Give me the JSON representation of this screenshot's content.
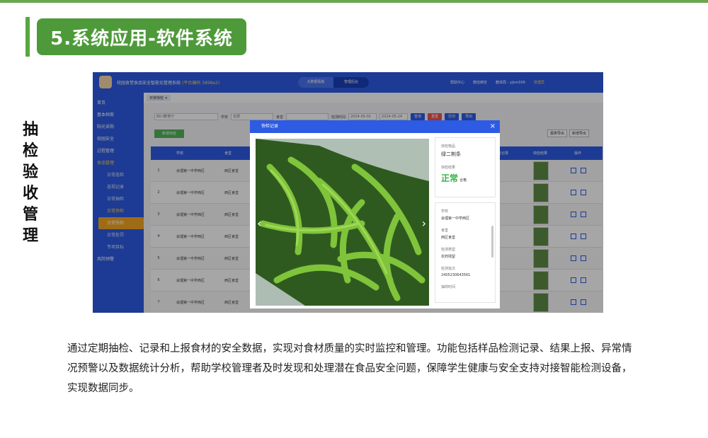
{
  "slide": {
    "title": "5.系统应用-软件系统",
    "side_title": "抽检验收管理",
    "description": "通过定期抽检、记录和上报食材的安全数据，实现对食材质量的实时监控和管理。功能包括样品检测记录、结果上报、异常情况预警以及数据统计分析，帮助学校管理者及时发现和处理潜在食品安全问题，保障学生健康与安全支持对接智能检测设备，实现数据同步。"
  },
  "app": {
    "name": "校园食堂食品安全智能化管理系统",
    "name_accent": "(平台编码 3898e2)",
    "segments": [
      "大数据看板",
      "管理后台"
    ],
    "header_right": [
      "帮助中心",
      "微信绑定",
      "教体局 - yjbm006",
      "管理员"
    ],
    "sidebar": [
      "首页",
      "基本档案",
      "阳光采购",
      "校园安全",
      "过程管理",
      "食品管理",
      "日常巡检",
      "巡视记录",
      "日常抽检",
      "日常快检",
      "日常快检",
      "日常处罚",
      "专项目标",
      "风险预警"
    ],
    "tab": "日常快检 ×",
    "filters": {
      "org": "四川教育厅",
      "school_label": "学校",
      "school": "全部",
      "canteen_label": "食堂",
      "date_label": "检测时间",
      "date_from": "2024-05-01",
      "date_to": "2024-05-24"
    },
    "buttons": {
      "search": "查询",
      "reset": "重置",
      "print": "打印",
      "export": "导出",
      "add": "新增快检",
      "r1": "报表导出",
      "r2": "新增导出"
    },
    "columns": [
      "学校",
      "食堂",
      "快检记录",
      "快检结果",
      "操作"
    ],
    "rows": [
      {
        "idx": "1",
        "school": "会理第一中学西区",
        "canteen": "西区食堂"
      },
      {
        "idx": "2",
        "school": "会理第一中学西区",
        "canteen": "西区食堂"
      },
      {
        "idx": "3",
        "school": "会理第一中学西区",
        "canteen": "西区食堂"
      },
      {
        "idx": "4",
        "school": "会理第一中学西区",
        "canteen": "西区食堂"
      },
      {
        "idx": "5",
        "school": "会理第一中学西区",
        "canteen": "西区食堂"
      },
      {
        "idx": "6",
        "school": "会理第一中学西区",
        "canteen": "西区食堂"
      },
      {
        "idx": "7",
        "school": "会理第一中学西区",
        "canteen": "西区食堂"
      }
    ]
  },
  "modal": {
    "title": "快检记录",
    "item_label": "快检物品",
    "item_value": "绿二荆条",
    "result_label": "快检结果",
    "result_value": "正常",
    "result_unit": "合格",
    "school_label": "学校",
    "school_value": "会理第一中学西区",
    "canteen_label": "食堂",
    "canteen_value": "西区食堂",
    "type_label": "检测类型",
    "type_value": "农药残留",
    "batch_label": "检测批次",
    "batch_value": "2405230643561",
    "time_label": "抽样时间"
  },
  "colors": {
    "brand_green": "#4e9a3a",
    "app_blue": "#2d5be3",
    "ok_green": "#2fb344",
    "accent": "#ffd24a"
  }
}
